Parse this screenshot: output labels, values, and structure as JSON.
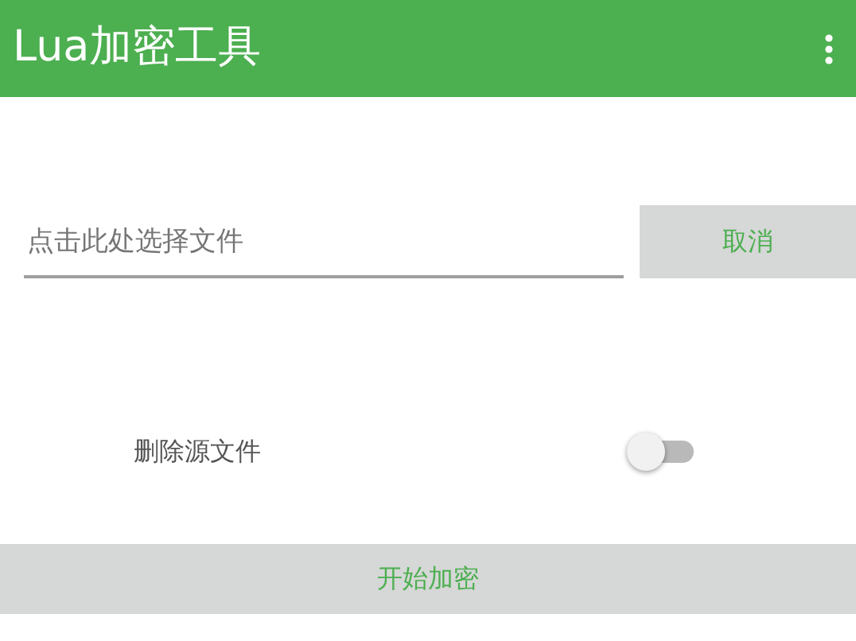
{
  "app_bar": {
    "title": "Lua加密工具"
  },
  "file_field": {
    "placeholder": "点击此处选择文件"
  },
  "cancel_button": {
    "label": "取消"
  },
  "delete_source": {
    "label": "删除源文件",
    "on": false
  },
  "start_button": {
    "label": "开始加密"
  }
}
